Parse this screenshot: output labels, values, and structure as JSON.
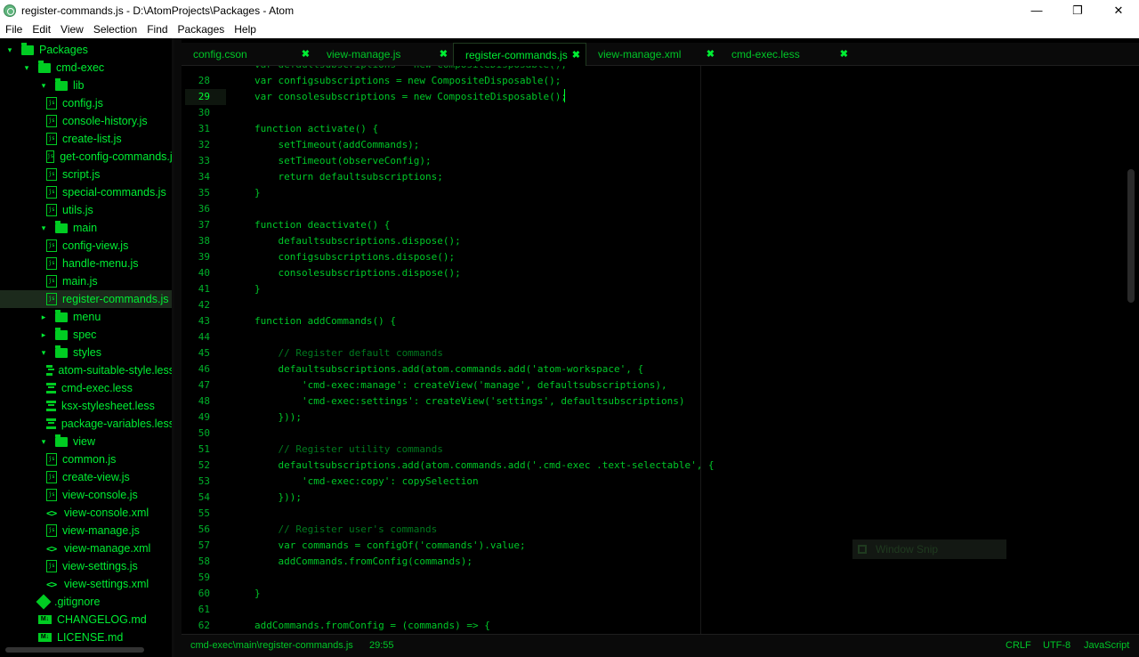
{
  "window": {
    "title": "register-commands.js - D:\\AtomProjects\\Packages - Atom",
    "minimize_glyph": "—",
    "maximize_glyph": "❐",
    "close_glyph": "✕"
  },
  "menu": [
    "File",
    "Edit",
    "View",
    "Selection",
    "Find",
    "Packages",
    "Help"
  ],
  "tree": {
    "items": [
      {
        "label": "Packages",
        "icon": "folder",
        "arrow": "▾"
      },
      {
        "label": "cmd-exec",
        "icon": "folder",
        "arrow": "▾"
      },
      {
        "label": "lib",
        "icon": "folder",
        "arrow": "▾"
      },
      {
        "label": "config.js",
        "icon": "js"
      },
      {
        "label": "console-history.js",
        "icon": "js"
      },
      {
        "label": "create-list.js",
        "icon": "js"
      },
      {
        "label": "get-config-commands.js",
        "icon": "js"
      },
      {
        "label": "script.js",
        "icon": "js"
      },
      {
        "label": "special-commands.js",
        "icon": "js"
      },
      {
        "label": "utils.js",
        "icon": "js"
      },
      {
        "label": "main",
        "icon": "folder",
        "arrow": "▾"
      },
      {
        "label": "config-view.js",
        "icon": "js"
      },
      {
        "label": "handle-menu.js",
        "icon": "js"
      },
      {
        "label": "main.js",
        "icon": "js"
      },
      {
        "label": "register-commands.js",
        "icon": "js",
        "selected": true
      },
      {
        "label": "menu",
        "icon": "folder",
        "arrow": "▸"
      },
      {
        "label": "spec",
        "icon": "folder",
        "arrow": "▸"
      },
      {
        "label": "styles",
        "icon": "folder",
        "arrow": "▾"
      },
      {
        "label": "atom-suitable-style.less",
        "icon": "less"
      },
      {
        "label": "cmd-exec.less",
        "icon": "less"
      },
      {
        "label": "ksx-stylesheet.less",
        "icon": "less"
      },
      {
        "label": "package-variables.less",
        "icon": "less"
      },
      {
        "label": "view",
        "icon": "folder",
        "arrow": "▾"
      },
      {
        "label": "common.js",
        "icon": "js"
      },
      {
        "label": "create-view.js",
        "icon": "js"
      },
      {
        "label": "view-console.js",
        "icon": "js"
      },
      {
        "label": "view-console.xml",
        "icon": "code"
      },
      {
        "label": "view-manage.js",
        "icon": "js"
      },
      {
        "label": "view-manage.xml",
        "icon": "code"
      },
      {
        "label": "view-settings.js",
        "icon": "js"
      },
      {
        "label": "view-settings.xml",
        "icon": "code"
      },
      {
        "label": ".gitignore",
        "icon": "git"
      },
      {
        "label": "CHANGELOG.md",
        "icon": "md"
      },
      {
        "label": "LICENSE.md",
        "icon": "md"
      }
    ]
  },
  "tabs": [
    {
      "label": "config.cson",
      "close": "✖",
      "active": false
    },
    {
      "label": "view-manage.js",
      "close": "✖",
      "active": false
    },
    {
      "label": "register-commands.js",
      "close": "✖",
      "active": true
    },
    {
      "label": "view-manage.xml",
      "close": "✖",
      "active": false
    },
    {
      "label": "cmd-exec.less",
      "close": "✖",
      "active": false
    }
  ],
  "editor": {
    "current_line": 29,
    "lines": [
      {
        "n": "",
        "text": "var defaultsubscriptions = new CompositeDisposable();",
        "cut": true
      },
      {
        "n": "28",
        "text": "var configsubscriptions = new CompositeDisposable();"
      },
      {
        "n": "29",
        "text": "var consolesubscriptions = new CompositeDisposable();"
      },
      {
        "n": "30",
        "text": ""
      },
      {
        "n": "31",
        "text": "function activate() {"
      },
      {
        "n": "32",
        "text": "    setTimeout(addCommands);"
      },
      {
        "n": "33",
        "text": "    setTimeout(observeConfig);"
      },
      {
        "n": "34",
        "text": "    return defaultsubscriptions;"
      },
      {
        "n": "35",
        "text": "}"
      },
      {
        "n": "36",
        "text": ""
      },
      {
        "n": "37",
        "text": "function deactivate() {"
      },
      {
        "n": "38",
        "text": "    defaultsubscriptions.dispose();"
      },
      {
        "n": "39",
        "text": "    configsubscriptions.dispose();"
      },
      {
        "n": "40",
        "text": "    consolesubscriptions.dispose();"
      },
      {
        "n": "41",
        "text": "}"
      },
      {
        "n": "42",
        "text": ""
      },
      {
        "n": "43",
        "text": "function addCommands() {"
      },
      {
        "n": "44",
        "text": ""
      },
      {
        "n": "45",
        "text": "    // Register default commands",
        "comment": true
      },
      {
        "n": "46",
        "text": "    defaultsubscriptions.add(atom.commands.add('atom-workspace', {"
      },
      {
        "n": "47",
        "text": "        'cmd-exec:manage': createView('manage', defaultsubscriptions),"
      },
      {
        "n": "48",
        "text": "        'cmd-exec:settings': createView('settings', defaultsubscriptions)"
      },
      {
        "n": "49",
        "text": "    }));"
      },
      {
        "n": "50",
        "text": ""
      },
      {
        "n": "51",
        "text": "    // Register utility commands",
        "comment": true
      },
      {
        "n": "52",
        "text": "    defaultsubscriptions.add(atom.commands.add('.cmd-exec .text-selectable', {"
      },
      {
        "n": "53",
        "text": "        'cmd-exec:copy': copySelection"
      },
      {
        "n": "54",
        "text": "    }));"
      },
      {
        "n": "55",
        "text": ""
      },
      {
        "n": "56",
        "text": "    // Register user's commands",
        "comment": true
      },
      {
        "n": "57",
        "text": "    var commands = configOf('commands').value;"
      },
      {
        "n": "58",
        "text": "    addCommands.fromConfig(commands);"
      },
      {
        "n": "59",
        "text": ""
      },
      {
        "n": "60",
        "text": "}"
      },
      {
        "n": "61",
        "text": ""
      },
      {
        "n": "62",
        "text": "addCommands.fromConfig = (commands) => {"
      }
    ]
  },
  "overlay": {
    "label": "Window Snip"
  },
  "status": {
    "path": "cmd-exec\\main\\register-commands.js",
    "cursor": "29:55",
    "line_ending": "CRLF",
    "encoding": "UTF-8",
    "grammar": "JavaScript"
  },
  "colors": {
    "accent": "#00ee33",
    "background": "#000000",
    "comment": "#007a1e"
  }
}
